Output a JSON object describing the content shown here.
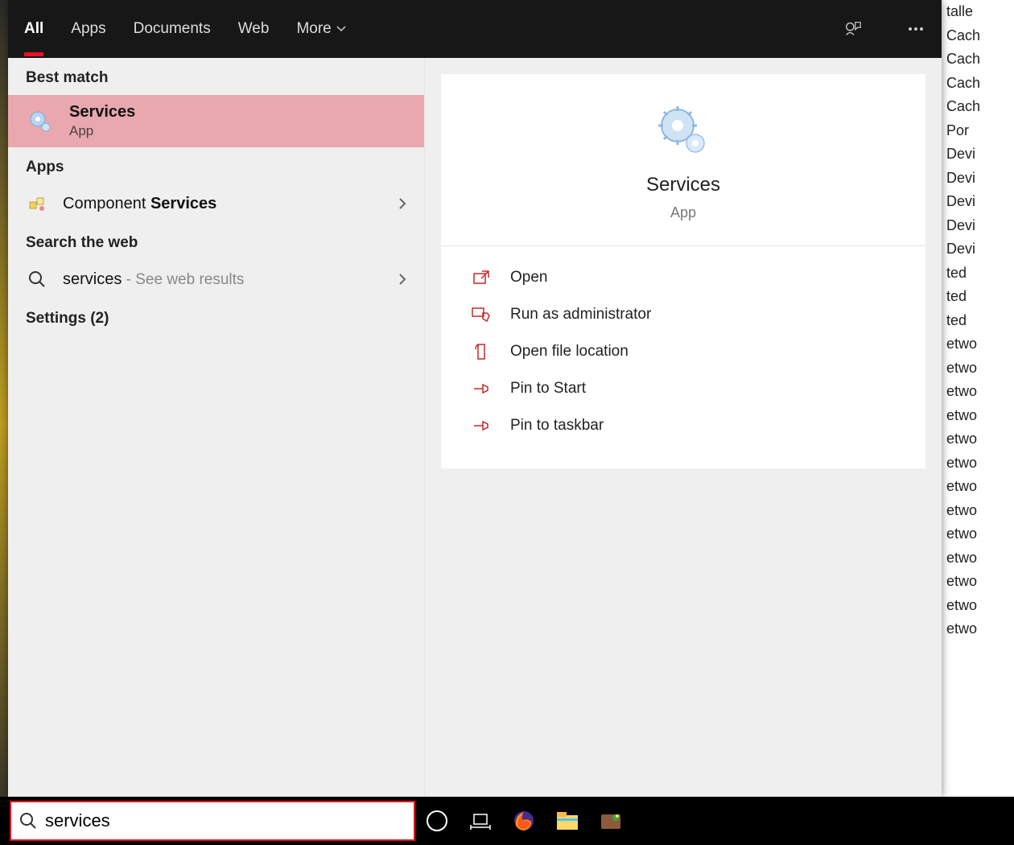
{
  "tabs": [
    "All",
    "Apps",
    "Documents",
    "Web",
    "More"
  ],
  "active_tab": "All",
  "sections": {
    "best_match": "Best match",
    "apps": "Apps",
    "web": "Search the web",
    "settings": "Settings (2)"
  },
  "best_match": {
    "title": "Services",
    "subtitle": "App"
  },
  "apps_results": [
    {
      "prefix": "Component ",
      "match": "Services"
    }
  ],
  "web_results": [
    {
      "query": "services",
      "hint": " - See web results"
    }
  ],
  "preview": {
    "title": "Services",
    "subtitle": "App"
  },
  "actions": [
    "Open",
    "Run as administrator",
    "Open file location",
    "Pin to Start",
    "Pin to taskbar"
  ],
  "search_value": "services",
  "bg_lines": [
    "talle",
    "Cach",
    "Cach",
    "Cach",
    "Cach",
    "Por",
    "Devi",
    "Devi",
    "Devi",
    "Devi",
    "Devi",
    "ted",
    "ted",
    "ted",
    "etwo",
    "etwo",
    "etwo",
    "etwo",
    "etwo",
    "etwo",
    "etwo",
    "etwo",
    "etwo",
    "etwo",
    "etwo",
    "etwo",
    "etwo"
  ]
}
